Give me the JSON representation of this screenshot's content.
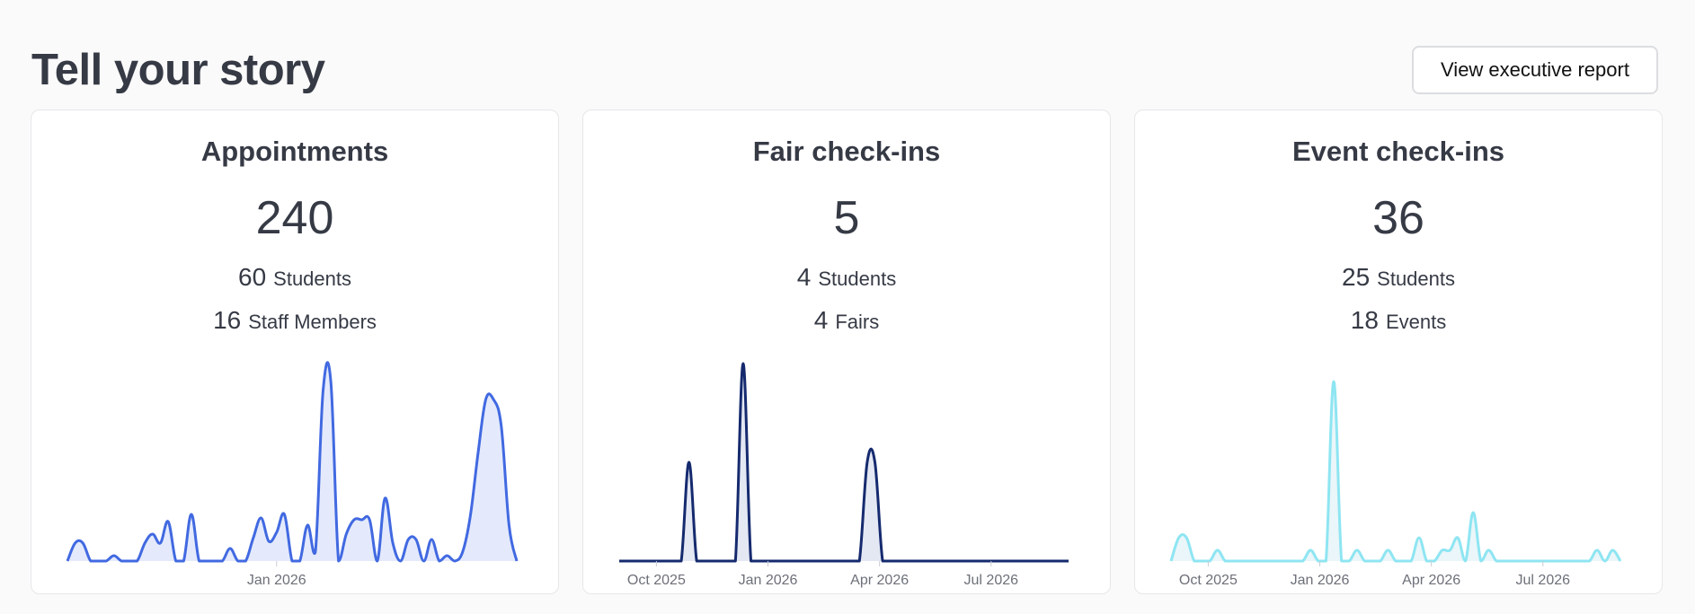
{
  "header": {
    "title": "Tell your story",
    "report_button": "View executive report"
  },
  "cards": [
    {
      "title": "Appointments",
      "total": "240",
      "stats": [
        {
          "value": "60",
          "label": "Students"
        },
        {
          "value": "16",
          "label": "Staff Members"
        }
      ]
    },
    {
      "title": "Fair check-ins",
      "total": "5",
      "stats": [
        {
          "value": "4",
          "label": "Students"
        },
        {
          "value": "4",
          "label": "Fairs"
        }
      ]
    },
    {
      "title": "Event check-ins",
      "total": "36",
      "stats": [
        {
          "value": "25",
          "label": "Students"
        },
        {
          "value": "18",
          "label": "Events"
        }
      ]
    }
  ],
  "chart_data": [
    {
      "type": "area",
      "title": "",
      "color": "#4169e1",
      "fill": "#e4eafc",
      "ylim": [
        0,
        11
      ],
      "x_ticks": [
        "Jan 2026"
      ],
      "x_tick_index": [
        27
      ],
      "series": [
        {
          "values": [
            0,
            1,
            1,
            0,
            0,
            0,
            0.3,
            0,
            0,
            0,
            1,
            1.5,
            1,
            2.2,
            0,
            0,
            2.6,
            0,
            0,
            0,
            0,
            0.7,
            0,
            0,
            1.3,
            2.4,
            1.1,
            1.6,
            2.6,
            0,
            0,
            2,
            0.5,
            9.5,
            10,
            0,
            1.5,
            2.3,
            2.3,
            2.3,
            0,
            3.5,
            1,
            0,
            1.2,
            1.2,
            0,
            1.2,
            0,
            0.3,
            0,
            0.5,
            2.5,
            6,
            9,
            9,
            7.5,
            2,
            0
          ]
        }
      ]
    },
    {
      "type": "area",
      "title": "",
      "color": "#152a6e",
      "fill": "#e4e8f3",
      "ylim": [
        0,
        11
      ],
      "x_ticks": [
        "Oct 2025",
        "Jan 2026",
        "Apr 2026",
        "Jul 2026"
      ],
      "x_tick_index": [
        4.8,
        19.2,
        33.6,
        48
      ],
      "series": [
        {
          "values": [
            0,
            0,
            0,
            0,
            0,
            0,
            0,
            0,
            0,
            5.5,
            0,
            0,
            0,
            0,
            0,
            0,
            11,
            0,
            0,
            0,
            0,
            0,
            0,
            0,
            0,
            0,
            0,
            0,
            0,
            0,
            0,
            0,
            5.5,
            5.5,
            0,
            0,
            0,
            0,
            0,
            0,
            0,
            0,
            0,
            0,
            0,
            0,
            0,
            0,
            0,
            0,
            0,
            0,
            0,
            0,
            0,
            0,
            0,
            0,
            0
          ]
        }
      ]
    },
    {
      "type": "area",
      "title": "",
      "color": "#8ee5f2",
      "fill": "#eaf6f9",
      "ylim": [
        0,
        11
      ],
      "x_ticks": [
        "Oct 2025",
        "Jan 2026",
        "Apr 2026",
        "Jul 2026"
      ],
      "x_tick_index": [
        4.8,
        19.2,
        33.6,
        48
      ],
      "series": [
        {
          "values": [
            0,
            1.3,
            1.3,
            0,
            0,
            0,
            0.6,
            0,
            0,
            0,
            0,
            0,
            0,
            0,
            0,
            0,
            0,
            0,
            0.6,
            0,
            0,
            10,
            0,
            0,
            0.6,
            0,
            0,
            0,
            0.6,
            0,
            0,
            0,
            1.3,
            0,
            0,
            0.6,
            0.6,
            1.3,
            0,
            2.7,
            0,
            0.6,
            0,
            0,
            0,
            0,
            0,
            0,
            0,
            0,
            0,
            0,
            0,
            0,
            0,
            0.6,
            0,
            0.6,
            0
          ]
        }
      ]
    }
  ]
}
